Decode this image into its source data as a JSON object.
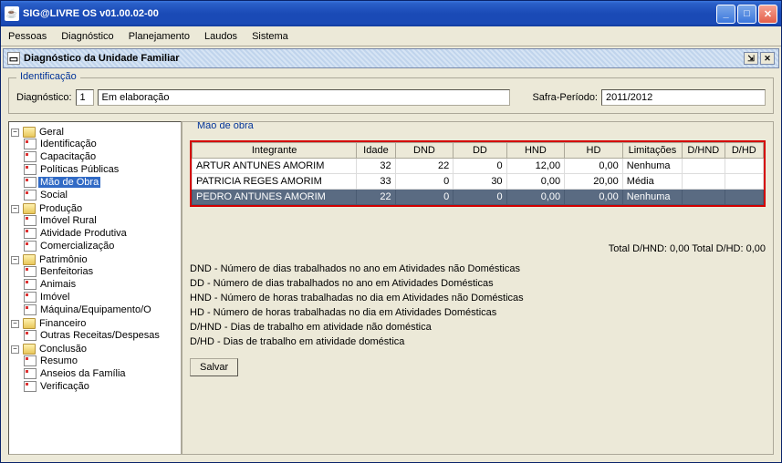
{
  "window": {
    "title": "SIG@LIVRE OS v01.00.02-00"
  },
  "menu": {
    "pessoas": "Pessoas",
    "diagnostico": "Diagnóstico",
    "planejamento": "Planejamento",
    "laudos": "Laudos",
    "sistema": "Sistema"
  },
  "subwindow": {
    "title": "Diagnóstico da Unidade Familiar"
  },
  "ident": {
    "legend": "Identificação",
    "diag_label": "Diagnóstico:",
    "diag_value": "1",
    "status": "Em elaboração",
    "safra_label": "Safra-Período:",
    "safra_value": "2011/2012"
  },
  "tree": {
    "geral": "Geral",
    "identificacao": "Identificação",
    "capacitacao": "Capacitação",
    "politicas": "Políticas Públicas",
    "mao_obra": "Mão de Obra",
    "social": "Social",
    "producao": "Produção",
    "imovel_rural": "Imóvel Rural",
    "atividade": "Atividade Produtiva",
    "comercializacao": "Comercialização",
    "patrimonio": "Patrimônio",
    "benfeitorias": "Benfeitorias",
    "animais": "Animais",
    "imovel": "Imóvel",
    "maquina": "Máquina/Equipamento/O",
    "financeiro": "Financeiro",
    "outras_receitas": "Outras Receitas/Despesas",
    "conclusao": "Conclusão",
    "resumo": "Resumo",
    "anseios": "Anseios da Família",
    "verificacao": "Verificação"
  },
  "main": {
    "legend": "Mão de obra",
    "headers": {
      "integrante": "Integrante",
      "idade": "Idade",
      "dnd": "DND",
      "dd": "DD",
      "hnd": "HND",
      "hd": "HD",
      "limitacoes": "Limitações",
      "dhnd": "D/HND",
      "dhd": "D/HD"
    },
    "rows": [
      {
        "integrante": "ARTUR ANTUNES AMORIM",
        "idade": "32",
        "dnd": "22",
        "dd": "0",
        "hnd": "12,00",
        "hd": "0,00",
        "lim": "Nenhuma",
        "dhnd": "",
        "dhd": ""
      },
      {
        "integrante": "PATRICIA REGES AMORIM",
        "idade": "33",
        "dnd": "0",
        "dd": "30",
        "hnd": "0,00",
        "hd": "20,00",
        "lim": "Média",
        "dhnd": "",
        "dhd": ""
      },
      {
        "integrante": "PEDRO ANTUNES AMORIM",
        "idade": "22",
        "dnd": "0",
        "dd": "0",
        "hnd": "0,00",
        "hd": "0,00",
        "lim": "Nenhuma",
        "dhnd": "",
        "dhd": ""
      }
    ],
    "totals": "Total D/HND: 0,00 Total D/HD: 0,00",
    "legends": {
      "dnd": "DND - Número de dias trabalhados no ano em Atividades não Domésticas",
      "dd": "DD - Número de dias trabalhados no ano em Atividades Domésticas",
      "hnd": "HND - Número de horas trabalhadas no dia em Atividades não Domésticas",
      "hd": "HD - Número de horas trabalhadas no dia em Atividades Domésticas",
      "dhnd": "D/HND - Dias de trabalho em atividade não doméstica",
      "dhd": "D/HD - Dias de trabalho em atividade doméstica"
    },
    "save": "Salvar"
  }
}
